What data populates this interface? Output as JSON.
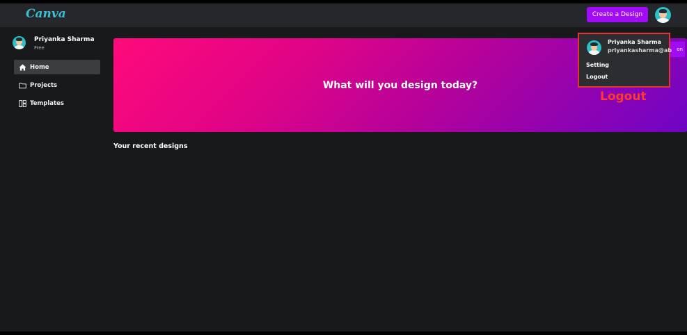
{
  "header": {
    "logo_text": "Canva",
    "logo_color": "#3bbfd6",
    "create_button": "Create a Design"
  },
  "sidebar": {
    "user_name": "Priyanka Sharma",
    "plan": "Free",
    "items": [
      {
        "label": "Home",
        "icon": "home-icon",
        "active": true
      },
      {
        "label": "Projects",
        "icon": "folder-icon",
        "active": false
      },
      {
        "label": "Templates",
        "icon": "templates-icon",
        "active": false
      }
    ]
  },
  "hero": {
    "title": "What will you design today?",
    "tab_fragment": "on"
  },
  "main": {
    "recent_title": "Your recent designs"
  },
  "dropdown": {
    "name": "Priyanka Sharma",
    "email": "priyankasharma@abc.com",
    "items": [
      "Setting",
      "Logout"
    ]
  },
  "annotation": {
    "label": "Logout",
    "color": "#ff3a2f"
  }
}
